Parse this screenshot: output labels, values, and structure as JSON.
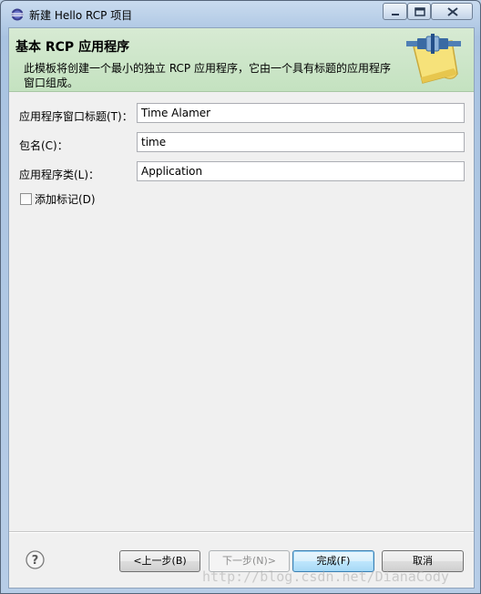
{
  "window": {
    "title": "新建 Hello RCP 项目"
  },
  "banner": {
    "title": "基本 RCP 应用程序",
    "description": "此模板将创建一个最小的独立 RCP 应用程序，它由一个具有标题的应用程序窗口组成。"
  },
  "form": {
    "window_title_label": "应用程序窗口标题(T)：",
    "window_title_value": "Time Alamer",
    "package_label": "包名(C)：",
    "package_value": "time",
    "app_class_label": "应用程序类(L)：",
    "app_class_value": "Application",
    "add_branding_label": "添加标记(D)",
    "add_branding_checked": false
  },
  "buttons": {
    "back": "<上一步(B)",
    "next": "下一步(N)>",
    "finish": "完成(F)",
    "cancel": "取消"
  },
  "watermark": "http://blog.csdn.net/DianaCody"
}
